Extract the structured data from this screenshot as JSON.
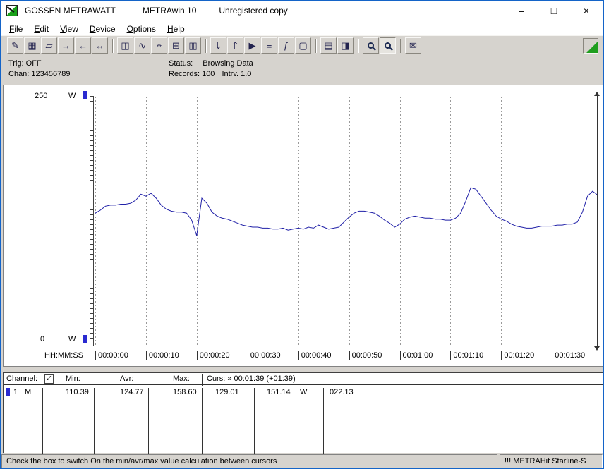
{
  "window": {
    "brand": "GOSSEN METRAWATT",
    "app": "METRAwin 10",
    "license": "Unregistered copy",
    "controls": {
      "minimize": "–",
      "maximize": "□",
      "close": "×"
    }
  },
  "menu": {
    "items": [
      "File",
      "Edit",
      "View",
      "Device",
      "Options",
      "Help"
    ]
  },
  "toolbar": {
    "items": [
      {
        "name": "save-as-button",
        "icon": "save-as-icon",
        "glyph": "✎"
      },
      {
        "name": "save-button",
        "icon": "save-icon",
        "glyph": "▦"
      },
      {
        "name": "open-button",
        "icon": "open-folder-icon",
        "glyph": "▱"
      },
      {
        "name": "export-button",
        "icon": "export-icon",
        "glyph": "→"
      },
      {
        "name": "import-button",
        "icon": "import-icon",
        "glyph": "←"
      },
      {
        "name": "transfer-button",
        "icon": "transfer-icon",
        "glyph": "↔"
      },
      {
        "separator": true
      },
      {
        "name": "meter-view-button",
        "icon": "meter-display-icon",
        "glyph": "◫"
      },
      {
        "name": "trend-view-button",
        "icon": "yt-chart-icon",
        "glyph": "∿"
      },
      {
        "name": "xy-view-button",
        "icon": "xy-chart-icon",
        "glyph": "⌖"
      },
      {
        "name": "table-view-button",
        "icon": "table-icon",
        "glyph": "⊞"
      },
      {
        "name": "bargraph-view-button",
        "icon": "bargraph-icon",
        "glyph": "▥"
      },
      {
        "separator": true
      },
      {
        "name": "read-device-button",
        "icon": "download-icon",
        "glyph": "⇓"
      },
      {
        "name": "write-device-button",
        "icon": "upload-icon",
        "glyph": "⇑"
      },
      {
        "name": "online-button",
        "icon": "play-icon",
        "glyph": "▶"
      },
      {
        "name": "device-settings-button",
        "icon": "settings-icon",
        "glyph": "≡"
      },
      {
        "name": "function-button",
        "icon": "fx-icon",
        "glyph": "ƒ"
      },
      {
        "name": "monitor-button",
        "icon": "monitor-icon",
        "glyph": "▢"
      },
      {
        "separator": true
      },
      {
        "name": "print-button",
        "icon": "printer-icon",
        "glyph": "▤"
      },
      {
        "name": "print-preview-button",
        "icon": "preview-icon",
        "glyph": "◨"
      },
      {
        "separator": true
      },
      {
        "name": "zoom-curve-button",
        "icon": "zoom-curve-icon",
        "shape": "mag"
      },
      {
        "name": "zoom-button",
        "icon": "zoom-icon",
        "shape": "mag",
        "pressed": true
      },
      {
        "separator": true
      },
      {
        "name": "comment-button",
        "icon": "comment-icon",
        "glyph": "✉"
      }
    ]
  },
  "info": {
    "trig": "Trig: OFF",
    "chan": "Chan: 123456789",
    "status_label": "Status:",
    "status_value": "Browsing Data",
    "records": "Records: 100",
    "interval": "Intrv. 1.0"
  },
  "chart_data": {
    "type": "line",
    "title": "",
    "x_axis_label": "HH:MM:SS",
    "x_start": "00:00:00",
    "interval_seconds": 1.0,
    "x_ticks": [
      "00:00:00",
      "00:00:10",
      "00:00:20",
      "00:00:30",
      "00:00:40",
      "00:00:50",
      "00:01:00",
      "00:01:10",
      "00:01:20",
      "00:01:30"
    ],
    "ylim": [
      0,
      250
    ],
    "y_axis_top_label": "250",
    "y_axis_bottom_label": "0",
    "y_unit": "W",
    "grid": "vertical-dotted",
    "line_color": "#2121a8",
    "cursor_time": "00:01:39",
    "series": [
      {
        "name": "Channel 1",
        "unit": "W",
        "values": [
          133,
          136,
          140,
          141,
          141,
          142,
          142,
          143,
          146,
          152,
          150,
          153,
          148,
          141,
          137,
          135,
          134,
          134,
          133,
          126,
          110.4,
          148,
          143,
          134,
          130,
          128,
          127,
          125,
          123,
          121,
          120,
          119,
          119,
          118,
          118,
          117,
          117,
          118,
          116,
          117,
          118,
          117,
          119,
          118,
          121,
          119,
          117,
          118,
          119,
          124,
          129,
          133,
          135,
          135,
          134,
          133,
          130,
          126,
          123,
          119,
          122,
          127,
          129,
          130,
          129,
          128,
          128,
          127,
          127,
          126,
          126,
          128,
          133,
          145,
          158.6,
          157,
          150,
          143,
          136,
          130,
          127,
          125,
          122,
          120,
          119,
          118,
          118,
          119,
          120,
          120,
          120,
          121,
          121,
          122,
          122,
          124,
          134,
          150,
          155,
          151.1
        ]
      }
    ]
  },
  "table": {
    "channel_label": "Channel:",
    "checkbox_glyph": "✓",
    "min_label": "Min:",
    "avr_label": "Avr:",
    "max_label": "Max:",
    "cursor_label": "Curs: » 00:01:39 (+01:39)",
    "row": {
      "num": "1",
      "flag": "M",
      "min": "110.39",
      "avr": "124.77",
      "max": "158.60",
      "cursor_a": "129.01",
      "cursor_b": "151.14",
      "cursor_b_unit": "W",
      "energy": "022.13"
    }
  },
  "statusbar": {
    "hint": "Check the box to switch On the min/avr/max value calculation between cursors",
    "device": "!!! METRAHit Starline-S"
  }
}
